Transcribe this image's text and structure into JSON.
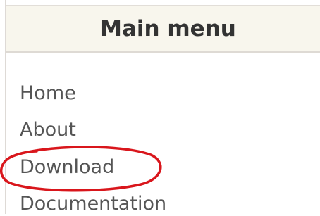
{
  "main_menu": {
    "title": "Main menu",
    "items": [
      {
        "label": "Home"
      },
      {
        "label": "About"
      },
      {
        "label": "Download"
      },
      {
        "label": "Documentation"
      }
    ]
  },
  "annotation": {
    "highlighted_item": "Download",
    "color": "#d9161c"
  },
  "colors": {
    "header_background": "#f8f6ed",
    "link_text": "#555555",
    "title_text": "#333333",
    "border": "#dedad6"
  }
}
